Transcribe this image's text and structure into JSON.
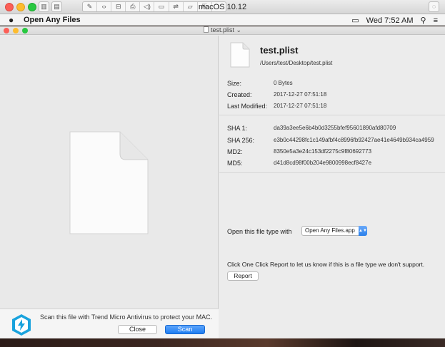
{
  "host": {
    "title": "macOS 10.12",
    "toolbar_icons": [
      "sidebar-icon",
      "snapshot-icon",
      "wrench-icon",
      "code-icon",
      "drive-icon",
      "printer-icon",
      "sound-icon",
      "camera-icon",
      "usb-icon",
      "folder-icon",
      "share-icon",
      "back-icon",
      "fullscreen-icon"
    ]
  },
  "menubar": {
    "app_name": "Open Any Files",
    "clock": "Wed 7:52 AM"
  },
  "window": {
    "title": "test.plist"
  },
  "file": {
    "name": "test.plist",
    "path": "/Users/test/Desktop/test.plist",
    "size_label": "Size:",
    "size": "0 Bytes",
    "created_label": "Created:",
    "created": "2017-12-27 07:51:18",
    "modified_label": "Last Modified:",
    "modified": "2017-12-27 07:51:18"
  },
  "hashes": {
    "sha1_label": "SHA 1:",
    "sha1": "da39a3ee5e6b4b0d3255bfef95601890afd80709",
    "sha256_label": "SHA 256:",
    "sha256": "e3b0c44298fc1c149afbf4c8996fb92427ae41e4649b934ca4959",
    "md2_label": "MD2:",
    "md2": "8350e5a3e24c153df2275c9f80692773",
    "md5_label": "MD5:",
    "md5": "d41d8cd98f00b204e9800998ecf8427e"
  },
  "open_with": {
    "label": "Open this file type with",
    "selected": "Open Any Files.app"
  },
  "report": {
    "text": "Click One Click Report to let us know if this is a file type we don't support.",
    "button": "Report"
  },
  "ad": {
    "text": "Scan this file with Trend Micro Antivirus to protect your MAC.",
    "close": "Close",
    "scan": "Scan"
  },
  "colors": {
    "accent": "#1d7df2",
    "close_dot": "#fc5f57",
    "min_dot": "#fdbc2e",
    "zoom_dot": "#28c840",
    "logo": "#1aa3dd"
  }
}
